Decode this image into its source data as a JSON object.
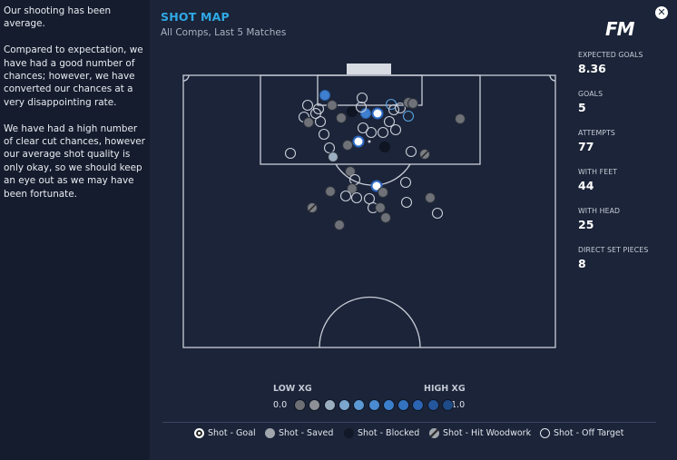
{
  "summary": {
    "p1": "Our shooting has been average.",
    "p2": "Compared to expectation, we have had a good number of chances; however, we have converted our chances at a very disappointing rate.",
    "p3": "We have had a high number of clear cut chances, however our average shot quality is only okay, so we should keep an eye out as we may have been fortunate."
  },
  "header": {
    "title": "SHOT MAP",
    "subtitle": "All Comps, Last 5 Matches",
    "logo": "FM"
  },
  "stats": [
    {
      "label": "EXPECTED GOALS",
      "value": "8.36"
    },
    {
      "label": "GOALS",
      "value": "5"
    },
    {
      "label": "ATTEMPTS",
      "value": "77"
    },
    {
      "label": "WITH FEET",
      "value": "44"
    },
    {
      "label": "WITH HEAD",
      "value": "25"
    },
    {
      "label": "DIRECT SET PIECES",
      "value": "8"
    }
  ],
  "xg_scale": {
    "low_label": "LOW XG",
    "high_label": "HIGH XG",
    "min": "0.0",
    "max": "1.0",
    "colors": [
      "#6d6f75",
      "#8d9096",
      "#9aaec0",
      "#7ba6cd",
      "#5c98d2",
      "#4a8ad0",
      "#3b7fcb",
      "#3373c0",
      "#2b64b0",
      "#24569c",
      "#1f4a88"
    ]
  },
  "legend": {
    "goal": "Shot - Goal",
    "saved": "Shot - Saved",
    "blocked": "Shot - Blocked",
    "woodwork": "Shot - Hit Woodwork",
    "off_target": "Shot - Off Target"
  },
  "colors": {
    "accent": "#2fa9e6",
    "background": "#1b2438",
    "panel": "#151c2d"
  }
}
